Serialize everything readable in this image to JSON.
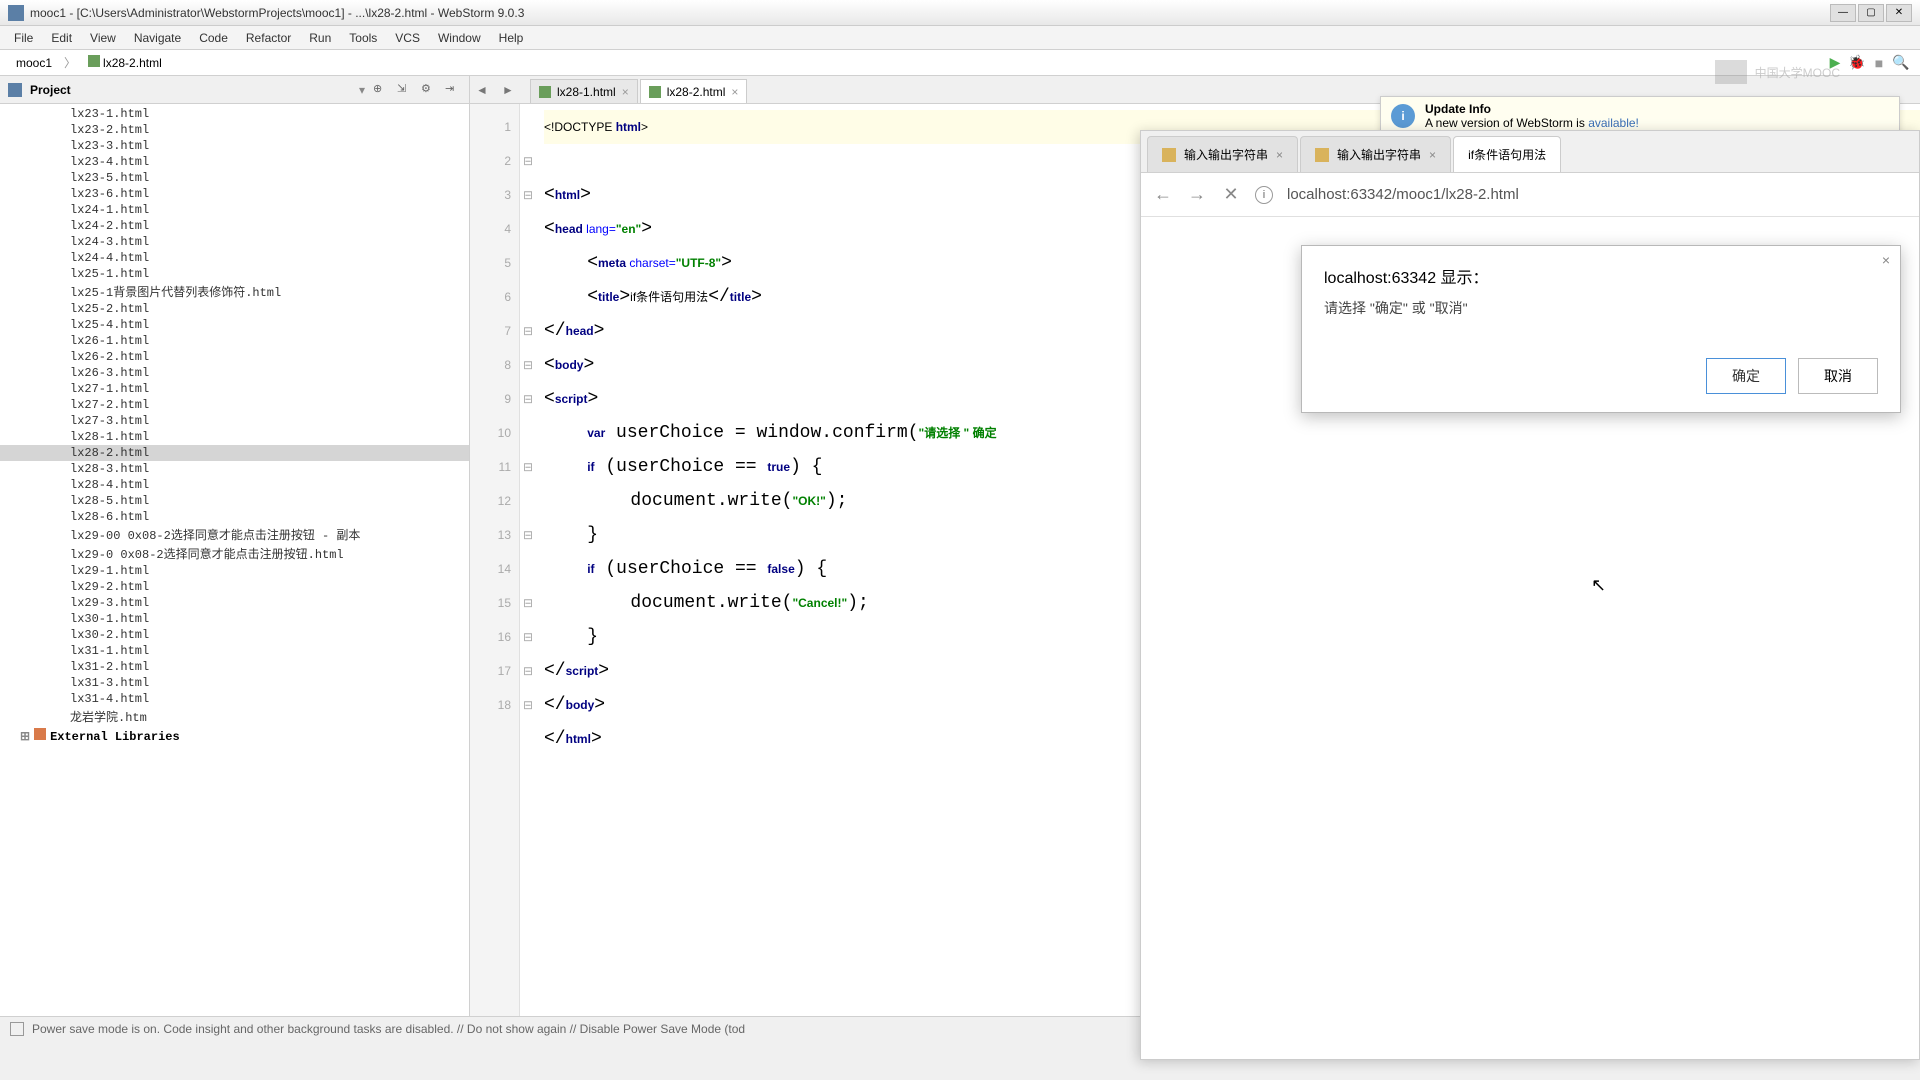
{
  "window": {
    "title": "mooc1 - [C:\\Users\\Administrator\\WebstormProjects\\mooc1] - ...\\lx28-2.html - WebStorm 9.0.3"
  },
  "menu": {
    "items": [
      "File",
      "Edit",
      "View",
      "Navigate",
      "Code",
      "Refactor",
      "Run",
      "Tools",
      "VCS",
      "Window",
      "Help"
    ]
  },
  "breadcrumb": {
    "project": "mooc1",
    "file": "lx28-2.html"
  },
  "sidebar": {
    "label": "Project",
    "files": [
      "lx23-1.html",
      "lx23-2.html",
      "lx23-3.html",
      "lx23-4.html",
      "lx23-5.html",
      "lx23-6.html",
      "lx24-1.html",
      "lx24-2.html",
      "lx24-3.html",
      "lx24-4.html",
      "lx25-1.html",
      "lx25-1背景图片代替列表修饰符.html",
      "lx25-2.html",
      "lx25-4.html",
      "lx26-1.html",
      "lx26-2.html",
      "lx26-3.html",
      "lx27-1.html",
      "lx27-2.html",
      "lx27-3.html",
      "lx28-1.html",
      "lx28-2.html",
      "lx28-3.html",
      "lx28-4.html",
      "lx28-5.html",
      "lx28-6.html",
      "lx29-00 0x08-2选择同意才能点击注册按钮 - 副本",
      "lx29-0 0x08-2选择同意才能点击注册按钮.html",
      "lx29-1.html",
      "lx29-2.html",
      "lx29-3.html",
      "lx30-1.html",
      "lx30-2.html",
      "lx31-1.html",
      "lx31-2.html",
      "lx31-3.html",
      "lx31-4.html",
      "龙岩学院.htm"
    ],
    "selected": "lx28-2.html",
    "external": "External Libraries"
  },
  "editor": {
    "tabs": [
      {
        "label": "lx28-1.html",
        "active": false
      },
      {
        "label": "lx28-2.html",
        "active": true
      }
    ],
    "gutter": [
      "1",
      "2",
      "3",
      "4",
      "5",
      "6",
      "7",
      "8",
      "9",
      "10",
      "11",
      "12",
      "13",
      "14",
      "15",
      "16",
      "17",
      "18"
    ],
    "fold": [
      "",
      "⊟",
      "⊟",
      "",
      "",
      "",
      "⊟",
      "⊟",
      "⊟",
      "",
      "⊟",
      "",
      "⊟",
      "",
      "⊟",
      "⊟",
      "⊟",
      "⊟"
    ],
    "code_lines": {
      "l1": "<!DOCTYPE html>",
      "l2": "<html>",
      "l3_a": "<head ",
      "l3_b": "lang=",
      "l3_c": "\"en\"",
      "l3_d": ">",
      "l4_a": "    <meta ",
      "l4_b": "charset=",
      "l4_c": "\"UTF-8\"",
      "l4_d": ">",
      "l5_a": "    <title>",
      "l5_b": "if条件语句用法",
      "l5_c": "</title>",
      "l6": "</head>",
      "l7": "<body>",
      "l8": "<script>",
      "l9_a": "    var ",
      "l9_b": "userChoice = window.confirm(",
      "l9_c": "\"请选择 \" 确定",
      "l10_a": "    if ",
      "l10_b": "(userChoice == ",
      "l10_c": "true",
      "l10_d": ") {",
      "l11_a": "        document.write(",
      "l11_b": "\"OK!\"",
      "l11_c": ");",
      "l12": "    }",
      "l13_a": "    if ",
      "l13_b": "(userChoice == ",
      "l13_c": "false",
      "l13_d": ") {",
      "l14_a": "        document.write(",
      "l14_b": "\"Cancel!\"",
      "l14_c": ");",
      "l15": "    }",
      "l16": "</script>",
      "l17": "</body>",
      "l18": "</html>"
    }
  },
  "statusbar": {
    "text": "Power save mode is on. Code insight and other background tasks are disabled. // Do not show again // Disable Power Save Mode (tod"
  },
  "watermark": "中国大学MOOC",
  "update": {
    "title": "Update Info",
    "body_a": "A new version of WebStorm is ",
    "body_b": "available!"
  },
  "browser": {
    "tabs": [
      {
        "label": "输入输出字符串",
        "active": false
      },
      {
        "label": "输入输出字符串",
        "active": false
      },
      {
        "label": "if条件语句用法",
        "active": true
      }
    ],
    "address": "localhost:63342/mooc1/lx28-2.html",
    "dialog": {
      "title": "localhost:63342 显示：",
      "message": "请选择 \"确定\" 或 \"取消\"",
      "ok": "确定",
      "cancel": "取消"
    }
  }
}
